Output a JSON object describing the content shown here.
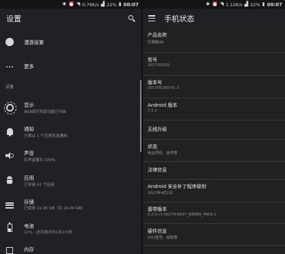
{
  "status_left": {
    "speed": "0.76K/s",
    "battery": "22%",
    "time": "00:07"
  },
  "status_right": {
    "speed": "1.12K/s",
    "battery": "22%",
    "time": "00:07"
  },
  "settings": {
    "title": "设置",
    "section_label": "设备",
    "items": [
      {
        "title": "漫游设置",
        "subtitle": "",
        "icon": "globe-icon"
      },
      {
        "title": "更多",
        "subtitle": "",
        "icon": "more-dots-icon"
      },
      {
        "title": "显示",
        "subtitle": "自动调节亮度功能已开启",
        "icon": "brightness-icon"
      },
      {
        "title": "通知",
        "subtitle": "已禁止 1 个应用发送通知",
        "icon": "bell-icon"
      },
      {
        "title": "声音",
        "subtitle": "铃声音量为 100%",
        "icon": "volume-icon"
      },
      {
        "title": "应用",
        "subtitle": "已安装 41 个应用",
        "icon": "android-icon"
      },
      {
        "title": "存储",
        "subtitle": "已使用 11.95 GB（共 16.00 GB）",
        "icon": "storage-icon"
      },
      {
        "title": "电池",
        "subtitle": "22% - 还可用大约1天2小时",
        "icon": "battery-icon"
      },
      {
        "title": "内存",
        "subtitle": "",
        "icon": "memory-icon"
      }
    ]
  },
  "phone_status": {
    "title": "手机状态",
    "items": [
      {
        "title": "产品名称",
        "subtitle": "红辣椒4A"
      },
      {
        "title": "型号",
        "subtitle": "20170520Q"
      },
      {
        "title": "版本号",
        "subtitle": "20170520Q-V1.1"
      },
      {
        "title": "Android 版本",
        "subtitle": "7.1.1"
      },
      {
        "title": "无线升级",
        "subtitle": ""
      },
      {
        "title": "状态",
        "subtitle": "电话号码、信号等"
      },
      {
        "title": "法律信息",
        "subtitle": ""
      },
      {
        "title": "Android 安全补丁程序级别",
        "subtitle": "2017年4月1日"
      },
      {
        "title": "基带版本",
        "subtitle": "0.2.0.c1-00179-8937_GENNS_PACK-1"
      },
      {
        "title": "硬件信息",
        "subtitle": "CPU型号、频率等"
      }
    ]
  }
}
